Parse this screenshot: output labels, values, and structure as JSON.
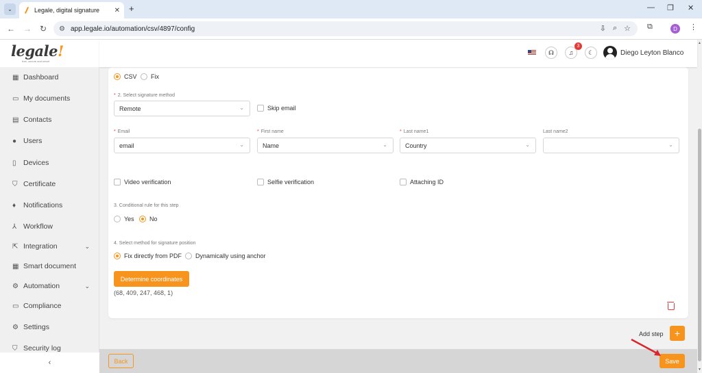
{
  "browser": {
    "tab_title": "Legale, digital signature",
    "tab_close": "✕",
    "new_tab": "+",
    "url": "app.legale.io/automation/csv/4897/config",
    "profile_initial": "D",
    "window_controls": {
      "minimize": "—",
      "restore": "❐",
      "close": "✕"
    }
  },
  "app": {
    "logo": "legale",
    "logo_tagline": "free, secure and smart",
    "accent_color": "#f7941d"
  },
  "sidebar": {
    "items": [
      {
        "label": "Dashboard",
        "icon": "dashboard-icon",
        "glyph": "▦"
      },
      {
        "label": "My documents",
        "icon": "folder-icon",
        "glyph": "▭"
      },
      {
        "label": "Contacts",
        "icon": "contacts-icon",
        "glyph": "▤"
      },
      {
        "label": "Users",
        "icon": "user-icon",
        "glyph": "●"
      },
      {
        "label": "Devices",
        "icon": "device-icon",
        "glyph": "▯"
      },
      {
        "label": "Certificate",
        "icon": "shield-icon",
        "glyph": "⛉"
      },
      {
        "label": "Notifications",
        "icon": "bell-icon",
        "glyph": "♦"
      },
      {
        "label": "Workflow",
        "icon": "workflow-icon",
        "glyph": "⅄"
      },
      {
        "label": "Integration",
        "icon": "integration-icon",
        "glyph": "⇱",
        "expandable": true
      },
      {
        "label": "Smart document",
        "icon": "smart-document-icon",
        "glyph": "▦"
      },
      {
        "label": "Automation",
        "icon": "automation-icon",
        "glyph": "⚙",
        "expandable": true
      },
      {
        "label": "Compliance",
        "icon": "compliance-icon",
        "glyph": "▭"
      },
      {
        "label": "Settings",
        "icon": "gear-icon",
        "glyph": "⚙"
      },
      {
        "label": "Security log",
        "icon": "security-log-icon",
        "glyph": "⛉"
      }
    ],
    "collapse_glyph": "‹",
    "chevron_glyph": "⌄"
  },
  "header": {
    "notification_count": "3",
    "user_name": "Diego Leyton Blanco"
  },
  "form": {
    "source": {
      "options": [
        "CSV",
        "Fix"
      ],
      "selected": "CSV"
    },
    "signature_method": {
      "label": "2. Select signature method",
      "value": "Remote"
    },
    "skip_email": {
      "label": "Skip email",
      "checked": false
    },
    "fields": [
      {
        "label": "Email",
        "required": true,
        "value": "email"
      },
      {
        "label": "First name",
        "required": true,
        "value": "Name"
      },
      {
        "label": "Last name1",
        "required": true,
        "value": "Country"
      },
      {
        "label": "Last name2",
        "required": false,
        "value": ""
      }
    ],
    "verifications": [
      "Video verification",
      "Selfie verification",
      "Attaching ID"
    ],
    "conditional_rule": {
      "label": "3. Conditional rule for this step",
      "options": [
        "Yes",
        "No"
      ],
      "selected": "No"
    },
    "position_method": {
      "label": "4. Select method for signature position",
      "options": [
        "Fix directly from PDF",
        "Dynamically using anchor"
      ],
      "selected": "Fix directly from PDF"
    },
    "determine_coordinates": "Determine coordinates",
    "coordinates": "(68, 409, 247, 468, 1)",
    "required_mark": "*",
    "dropdown_glyph": "⌄"
  },
  "actions": {
    "add_step": "Add step",
    "add_step_glyph": "+",
    "back": "Back",
    "save": "Save"
  }
}
